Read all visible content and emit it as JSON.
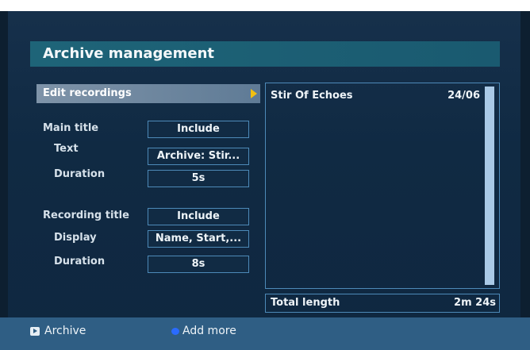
{
  "header": {
    "title": "Archive management"
  },
  "menu": {
    "edit_recordings": "Edit recordings"
  },
  "settings": {
    "main_title": {
      "label": "Main title",
      "value": "Include"
    },
    "main_text": {
      "label": "Text",
      "value": "Archive: Stir..."
    },
    "main_duration": {
      "label": "Duration",
      "value": "5s"
    },
    "recording_title": {
      "label": "Recording title",
      "value": "Include"
    },
    "recording_display": {
      "label": "Display",
      "value": "Name, Start,..."
    },
    "recording_duration": {
      "label": "Duration",
      "value": "8s"
    }
  },
  "recordings": [
    {
      "name": "Stir Of Echoes",
      "date": "24/06"
    }
  ],
  "total": {
    "label": "Total length",
    "value": "2m 24s"
  },
  "footer": {
    "archive_label": "Archive",
    "add_more_label": "Add more"
  },
  "colors": {
    "title_bar": "#1e6478",
    "highlight": "#f2c010",
    "blue_key": "#2a6bff",
    "footer": "#2f5e84"
  }
}
